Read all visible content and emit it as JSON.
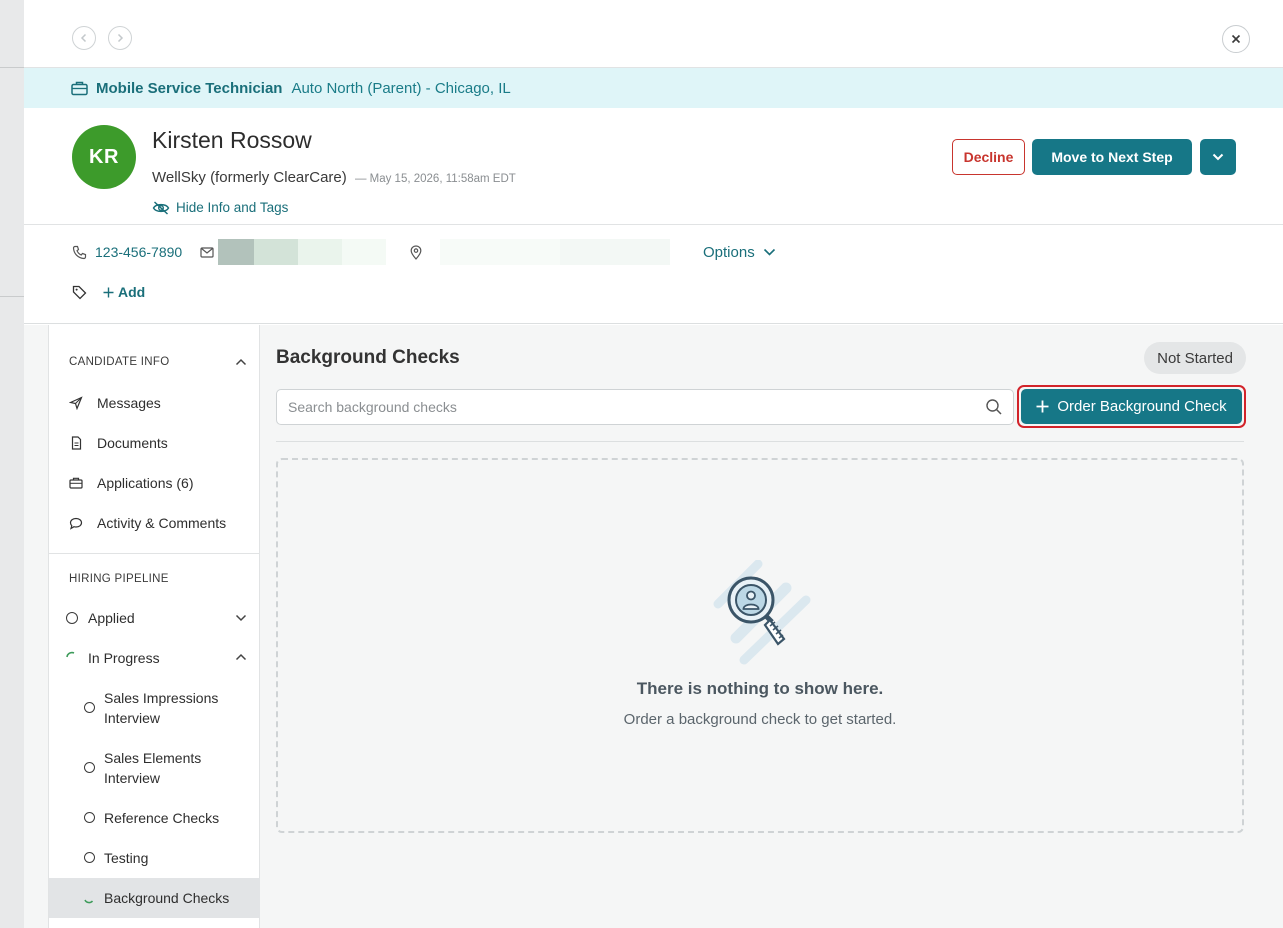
{
  "window": {
    "back_icon": "chevron-left-icon",
    "forward_icon": "chevron-right-icon",
    "close_icon": "close-icon"
  },
  "job": {
    "title": "Mobile Service Technician",
    "location": "Auto North (Parent) - Chicago, IL"
  },
  "candidate": {
    "initials": "KR",
    "name": "Kirsten Rossow",
    "company": "WellSky (formerly ClearCare)",
    "date": "— May 15, 2026, 11:58am EDT",
    "hide_info_label": "Hide Info and Tags",
    "decline_label": "Decline",
    "next_step_label": "Move to Next Step"
  },
  "contact": {
    "phone": "123-456-7890",
    "options_label": "Options",
    "add_tag_label": "Add"
  },
  "sidebar": {
    "candidate_info_title": "CANDIDATE INFO",
    "items": [
      {
        "label": "Messages"
      },
      {
        "label": "Documents"
      },
      {
        "label": "Applications (6)"
      },
      {
        "label": "Activity & Comments"
      }
    ],
    "pipeline_title": "HIRING PIPELINE",
    "pipeline": [
      {
        "label": "Applied"
      },
      {
        "label": "In Progress"
      },
      {
        "label": "Sales Impressions Interview"
      },
      {
        "label": "Sales Elements Interview"
      },
      {
        "label": "Reference Checks"
      },
      {
        "label": "Testing"
      },
      {
        "label": "Background Checks"
      }
    ]
  },
  "main": {
    "title": "Background Checks",
    "status": "Not Started",
    "search_placeholder": "Search background checks",
    "order_label": "Order Background Check",
    "empty_title": "There is nothing to show here.",
    "empty_subtitle": "Order a background check to get started."
  },
  "colors": {
    "brand": "#167787",
    "decline": "#c8352e",
    "avatar": "#3d9b2b",
    "banner": "#dff5f8",
    "highlight": "#d2232a"
  }
}
